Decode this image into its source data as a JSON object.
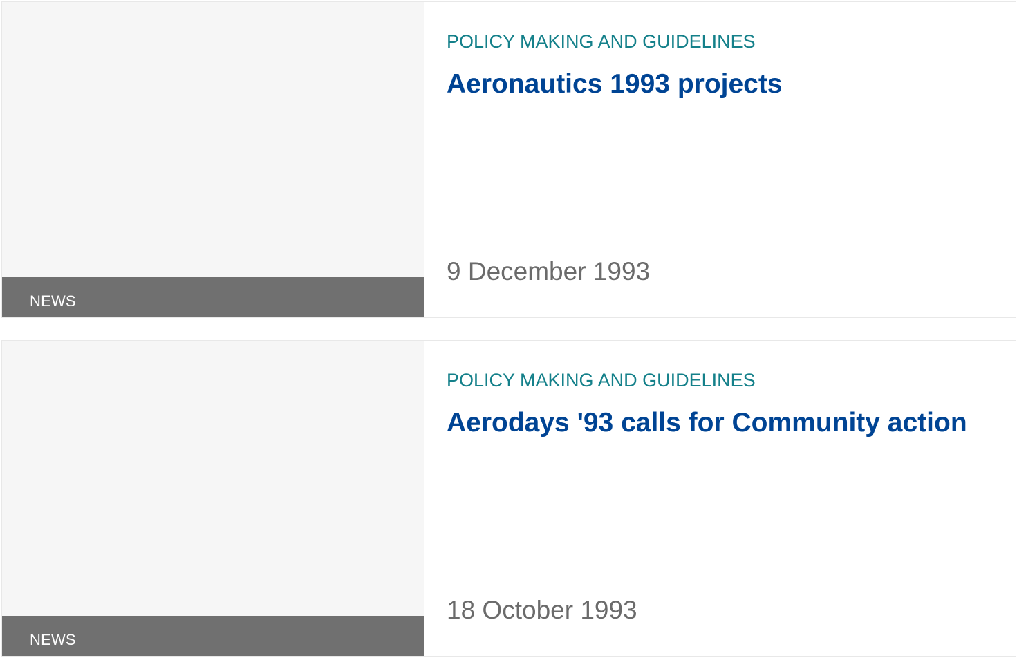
{
  "articles": [
    {
      "type_label": "NEWS",
      "category": "POLICY MAKING AND GUIDELINES",
      "title": "Aeronautics 1993 projects",
      "date": "9 December 1993"
    },
    {
      "type_label": "NEWS",
      "category": "POLICY MAKING AND GUIDELINES",
      "title": "Aerodays '93 calls for Community action",
      "date": "18 October 1993"
    }
  ],
  "colors": {
    "category": "#14808a",
    "title": "#004494",
    "date": "#6b6b6b",
    "badge_bg": "#707070",
    "thumb_bg": "#f6f6f6"
  }
}
